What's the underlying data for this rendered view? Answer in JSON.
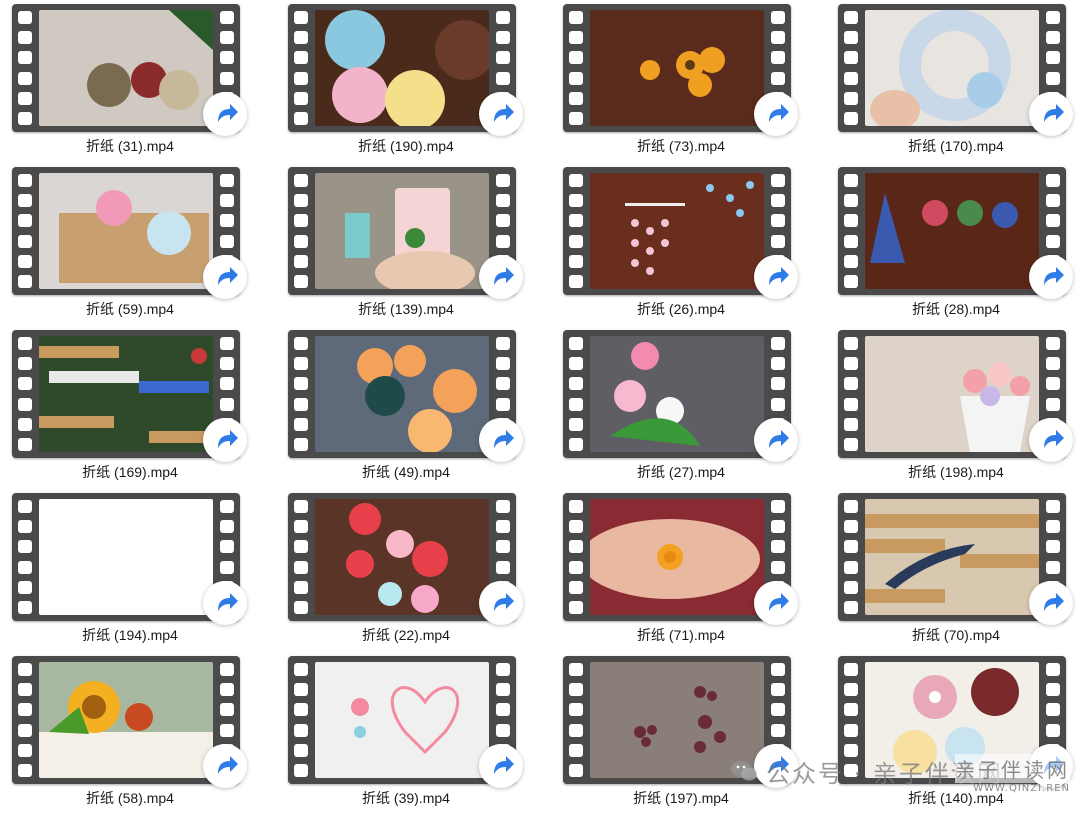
{
  "files": [
    {
      "name": "折纸 (31).mp4",
      "thumb": {
        "bg": "#cfc9c2",
        "accent": "#8a2a2a",
        "shape": "ornaments"
      }
    },
    {
      "name": "折纸 (190).mp4",
      "thumb": {
        "bg": "#4a2a1a",
        "accent": "#f3b3c8",
        "shape": "roses"
      }
    },
    {
      "name": "折纸 (73).mp4",
      "thumb": {
        "bg": "#5a2a1c",
        "accent": "#f0a020",
        "shape": "sunflowers"
      }
    },
    {
      "name": "折纸 (170).mp4",
      "thumb": {
        "bg": "#e8e4e0",
        "accent": "#a8cde8",
        "shape": "wreath"
      }
    },
    {
      "name": "折纸 (59).mp4",
      "thumb": {
        "bg": "#d9d6d3",
        "accent": "#f09ab8",
        "shape": "bows"
      }
    },
    {
      "name": "折纸 (139).mp4",
      "thumb": {
        "bg": "#9a9388",
        "accent": "#f4d4d4",
        "shape": "tag"
      }
    },
    {
      "name": "折纸 (26).mp4",
      "thumb": {
        "bg": "#6a2e1e",
        "accent": "#f4c4d4",
        "shape": "hanging"
      }
    },
    {
      "name": "折纸 (28).mp4",
      "thumb": {
        "bg": "#5a2618",
        "accent": "#d04a60",
        "shape": "cups"
      }
    },
    {
      "name": "折纸 (169).mp4",
      "thumb": {
        "bg": "#2f4a2a",
        "accent": "#3a6ad0",
        "shape": "tree"
      }
    },
    {
      "name": "折纸 (49).mp4",
      "thumb": {
        "bg": "#5e6a7a",
        "accent": "#f4a25a",
        "shape": "pumpkins"
      }
    },
    {
      "name": "折纸 (27).mp4",
      "thumb": {
        "bg": "#5e5e64",
        "accent": "#f48ab0",
        "shape": "daisies"
      }
    },
    {
      "name": "折纸 (198).mp4",
      "thumb": {
        "bg": "#ddd3c8",
        "accent": "#f4a0a8",
        "shape": "teacup"
      }
    },
    {
      "name": "折纸 (194).mp4",
      "thumb": {
        "bg": "#ffffff",
        "accent": "#ffffff",
        "shape": "blank"
      }
    },
    {
      "name": "折纸 (22).mp4",
      "thumb": {
        "bg": "#5a3426",
        "accent": "#e8404a",
        "shape": "hearts"
      }
    },
    {
      "name": "折纸 (71).mp4",
      "thumb": {
        "bg": "#8a2a32",
        "accent": "#f4a020",
        "shape": "hand"
      }
    },
    {
      "name": "折纸 (70).mp4",
      "thumb": {
        "bg": "#d8c8b0",
        "accent": "#2a3a5a",
        "shape": "feather"
      }
    },
    {
      "name": "折纸 (58).mp4",
      "thumb": {
        "bg": "#a8b8a0",
        "accent": "#f4b020",
        "shape": "cake"
      }
    },
    {
      "name": "折纸 (39).mp4",
      "thumb": {
        "bg": "#f0f0f0",
        "accent": "#f48aa0",
        "shape": "quillhearts"
      }
    },
    {
      "name": "折纸 (197).mp4",
      "thumb": {
        "bg": "#8a7e78",
        "accent": "#6a2a3a",
        "shape": "quillflowers"
      }
    },
    {
      "name": "折纸 (140).mp4",
      "thumb": {
        "bg": "#f2eee8",
        "accent": "#e8a8b8",
        "shape": "paperflowers"
      }
    }
  ],
  "watermark": {
    "text": "公众号 · 亲子伴读网",
    "site_cn": "亲子伴读网",
    "site_url": "WWW.QINZI.REN"
  },
  "colors": {
    "film": "#4a4a4a",
    "badge_arrow": "#2f7be8"
  },
  "icons": {
    "badge": "share-arrow-icon",
    "watermark": "wechat-icon"
  }
}
